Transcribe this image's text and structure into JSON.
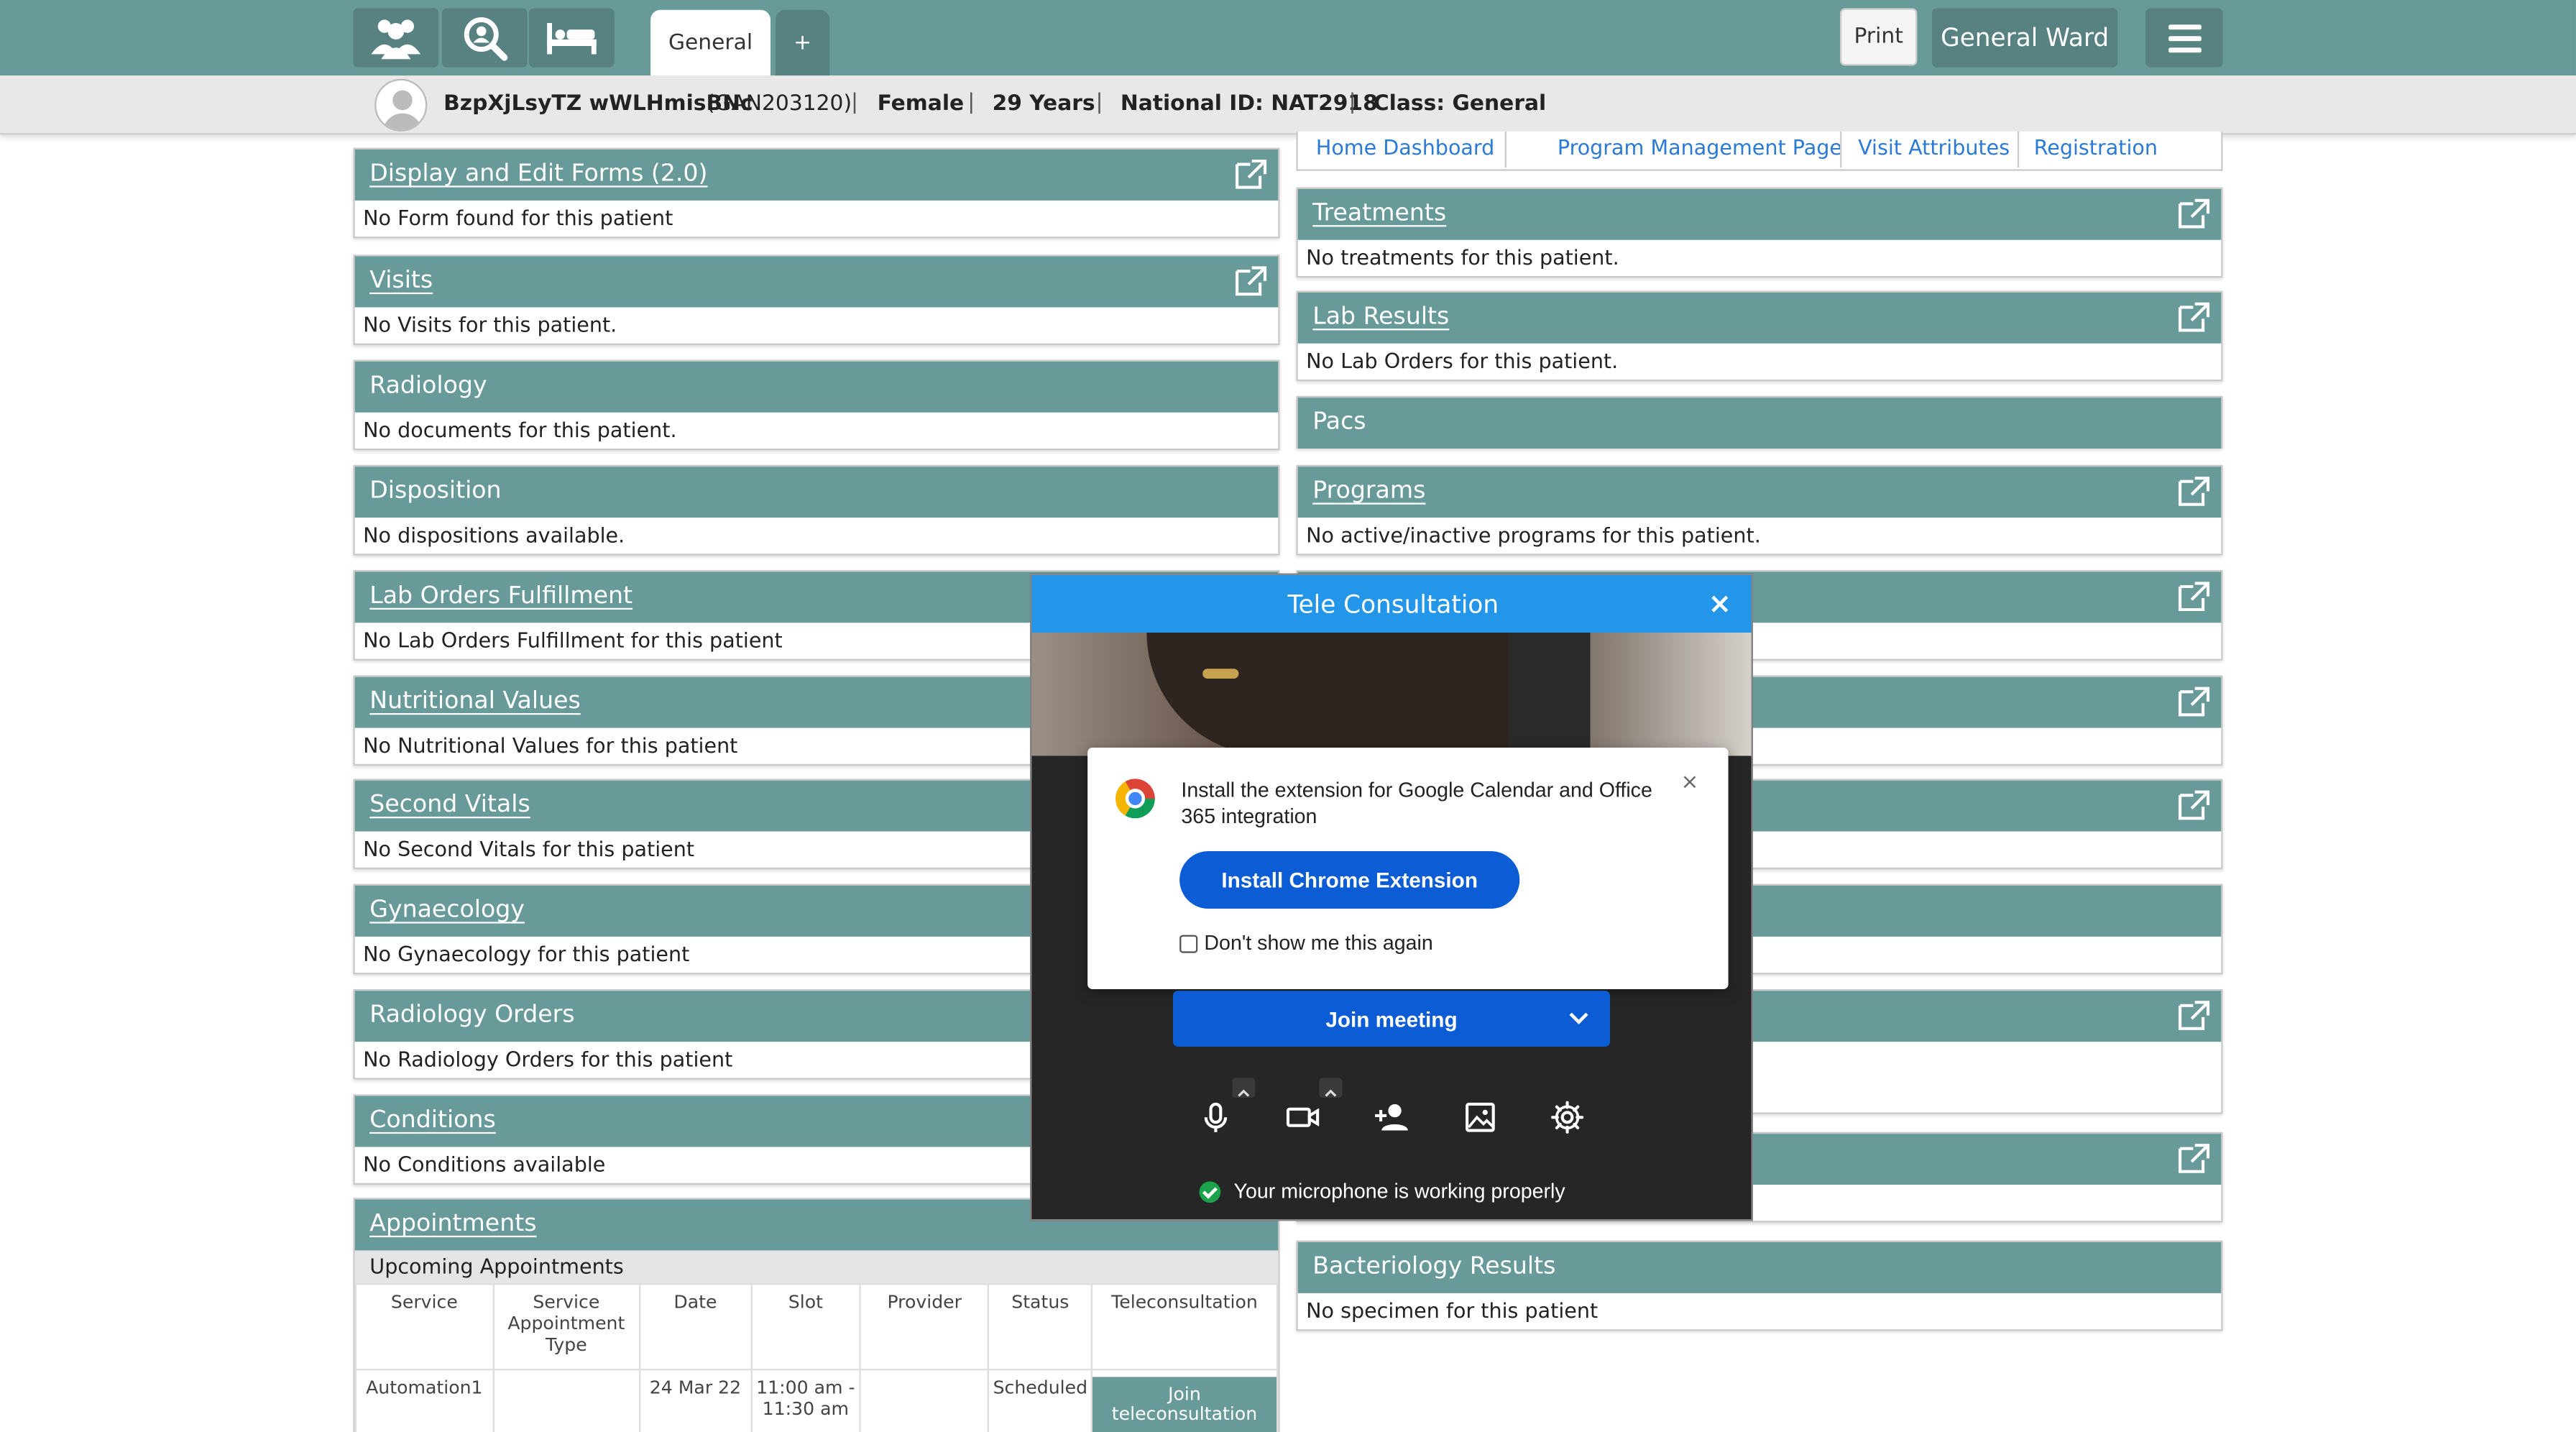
{
  "tabs": {
    "active": "General",
    "add": "+"
  },
  "toolbar": {
    "print": "Print",
    "ward": "General Ward"
  },
  "patient": {
    "name": "BzpXjLsyTZ wWLHmisBNc",
    "id": "(GAN203120)",
    "gender": "Female",
    "age": "29 Years",
    "national_id": "National ID: NAT2918",
    "class": "Class: General"
  },
  "links": [
    "Home Dashboard",
    "Program Management Page",
    "Visit Attributes",
    "Registration"
  ],
  "left_panels": [
    {
      "title": "Display and Edit Forms (2.0)",
      "body": "No Form found for this patient",
      "link": true
    },
    {
      "title": "Visits",
      "body": "No Visits for this patient.",
      "link": true
    },
    {
      "title": "Radiology",
      "body": "No documents for this patient.",
      "link": false
    },
    {
      "title": "Disposition",
      "body": "No dispositions available.",
      "link": false
    },
    {
      "title": "Lab Orders Fulfillment",
      "body": "No Lab Orders Fulfillment for this patient",
      "link": true
    },
    {
      "title": "Nutritional Values",
      "body": "No Nutritional Values for this patient",
      "link": true
    },
    {
      "title": "Second Vitals",
      "body": "No Second Vitals for this patient",
      "link": true
    },
    {
      "title": "Gynaecology",
      "body": "No Gynaecology for this patient",
      "link": true
    },
    {
      "title": "Radiology Orders",
      "body": "No Radiology Orders for this patient",
      "link": false
    },
    {
      "title": "Conditions",
      "body": "No Conditions available",
      "link": true
    }
  ],
  "right_panels": [
    {
      "title": "Treatments",
      "body": "No treatments for this patient.",
      "link": true
    },
    {
      "title": "Lab Results",
      "body": "No Lab Orders for this patient.",
      "link": true
    },
    {
      "title": "Pacs",
      "body": "",
      "link": false
    },
    {
      "title": "Programs",
      "body": "No active/inactive programs for this patient.",
      "link": true
    },
    {
      "title": "Bacteriology Results",
      "body": "No specimen for this patient",
      "link": false
    }
  ],
  "appointments": {
    "title": "Appointments",
    "subtitle": "Upcoming Appointments",
    "columns": [
      "Service",
      "Service Appointment Type",
      "Date",
      "Slot",
      "Provider",
      "Status",
      "Teleconsultation"
    ],
    "rows": [
      {
        "service": "Automation1",
        "type": "",
        "date": "24 Mar 22",
        "slot": "11:00 am - 11:30 am",
        "provider": "",
        "status": "Scheduled",
        "action": "Join teleconsultation"
      }
    ]
  },
  "modal": {
    "title": "Tele Consultation",
    "close": "×",
    "popup_text": "Install the extension for Google Calendar and Office 365 integration",
    "popup_close": "×",
    "install_button": "Install Chrome Extension",
    "dont_show": "Don't show me this again",
    "join_button": "Join meeting",
    "mic_status": "Your microphone is working properly"
  },
  "colors": {
    "teal": "#699a9a",
    "teal_dark": "#588282",
    "modal_blue": "#2496e9",
    "button_blue": "#0b5cd5"
  }
}
